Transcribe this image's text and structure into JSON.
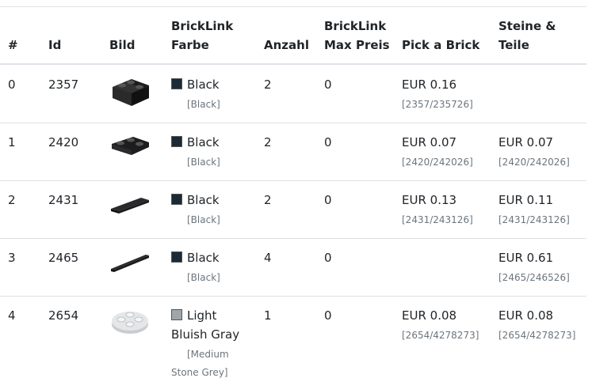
{
  "headers": {
    "num": "#",
    "id": "Id",
    "bild": "Bild",
    "farbe_l1": "BrickLink",
    "farbe_l2": "Farbe",
    "anzahl": "Anzahl",
    "maxpreis_l1": "BrickLink",
    "maxpreis_l2": "Max Preis",
    "pab": "Pick a Brick",
    "steine_l1": "Steine &",
    "steine_l2": "Teile"
  },
  "colors": {
    "black": "#1b2a34",
    "light_bluish_gray": "#a0a5a9"
  },
  "rows": [
    {
      "num": "0",
      "id": "2357",
      "image": "brick-corner-2x2-icon",
      "color_name": "Black",
      "color_sub": "[Black]",
      "count": "2",
      "max_price": "0",
      "pab_price": "EUR 0.16",
      "pab_ref": "[2357/235726]",
      "st_price": "",
      "st_ref": ""
    },
    {
      "num": "1",
      "id": "2420",
      "image": "plate-corner-2x2-icon",
      "color_name": "Black",
      "color_sub": "[Black]",
      "count": "2",
      "max_price": "0",
      "pab_price": "EUR 0.07",
      "pab_ref": "[2420/242026]",
      "st_price": "EUR 0.07",
      "st_ref": "[2420/242026]"
    },
    {
      "num": "2",
      "id": "2431",
      "image": "tile-1x4-icon",
      "color_name": "Black",
      "color_sub": "[Black]",
      "count": "2",
      "max_price": "0",
      "pab_price": "EUR 0.13",
      "pab_ref": "[2431/243126]",
      "st_price": "EUR 0.11",
      "st_ref": "[2431/243126]"
    },
    {
      "num": "3",
      "id": "2465",
      "image": "brick-1x16-icon",
      "color_name": "Black",
      "color_sub": "[Black]",
      "count": "4",
      "max_price": "0",
      "pab_price": "",
      "pab_ref": "",
      "st_price": "EUR 0.61",
      "st_ref": "[2465/246526]"
    },
    {
      "num": "4",
      "id": "2654",
      "image": "round-plate-2x2-icon",
      "color_name_l1": "Light",
      "color_name_l2": "Bluish Gray",
      "color_sub_l1": "[Medium",
      "color_sub_l2": "Stone Grey]",
      "count": "1",
      "max_price": "0",
      "pab_price": "EUR 0.08",
      "pab_ref": "[2654/4278273]",
      "st_price": "EUR 0.08",
      "st_ref": "[2654/4278273]"
    }
  ]
}
